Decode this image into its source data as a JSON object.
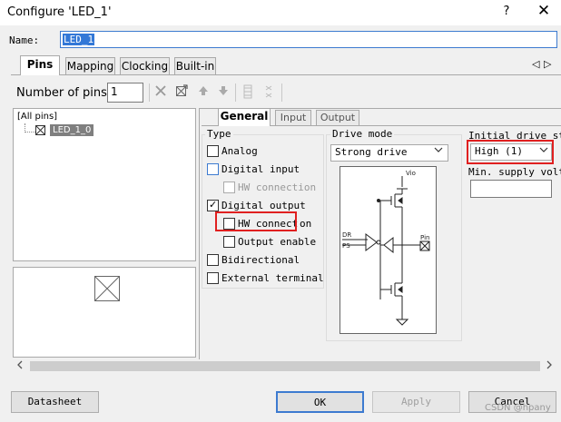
{
  "window": {
    "title": "Configure 'LED_1'",
    "help_glyph": "?",
    "close_glyph": "✕"
  },
  "name": {
    "label": "Name:",
    "value": "LED_1"
  },
  "tabs": [
    {
      "label": "Pins"
    },
    {
      "label": "Mapping"
    },
    {
      "label": "Clocking"
    },
    {
      "label": "Built-in"
    }
  ],
  "tab_nav": {
    "left": "◁",
    "right": "▷"
  },
  "pins": {
    "count_label": "Number of pins:",
    "count_value": "1",
    "tree": {
      "root": "[All pins]",
      "pin": "LED_1_0"
    }
  },
  "subtabs": [
    {
      "label": "General"
    },
    {
      "label": "Input"
    },
    {
      "label": "Output"
    }
  ],
  "type_group": {
    "title": "Type",
    "options": [
      {
        "label": "Analog",
        "checked": false
      },
      {
        "label": "Digital input",
        "checked": false
      },
      {
        "label": "HW connection",
        "checked": false
      },
      {
        "label": "Digital output",
        "checked": true
      },
      {
        "label": "HW connect",
        "suffix": "on",
        "checked": false
      },
      {
        "label": "Output enable",
        "checked": false
      },
      {
        "label": "Bidirectional",
        "checked": false
      },
      {
        "label": "External terminal",
        "checked": false
      }
    ]
  },
  "drive_mode": {
    "title": "Drive mode",
    "value": "Strong drive",
    "diagram": {
      "vio": "Vio",
      "dr": "DR",
      "ps": "PS",
      "pin": "Pin"
    }
  },
  "initial_drive": {
    "label": "Initial drive st",
    "value": "High (1)"
  },
  "min_supply": {
    "label": "Min. supply volt",
    "value": ""
  },
  "buttons": {
    "datasheet": "Datasheet",
    "ok": "OK",
    "apply": "Apply",
    "cancel": "Cancel"
  },
  "watermark": "CSDN @hpany",
  "colors": {
    "highlight": "#e02020",
    "selection": "#3378d7",
    "accent_border": "#3d7bd0"
  }
}
